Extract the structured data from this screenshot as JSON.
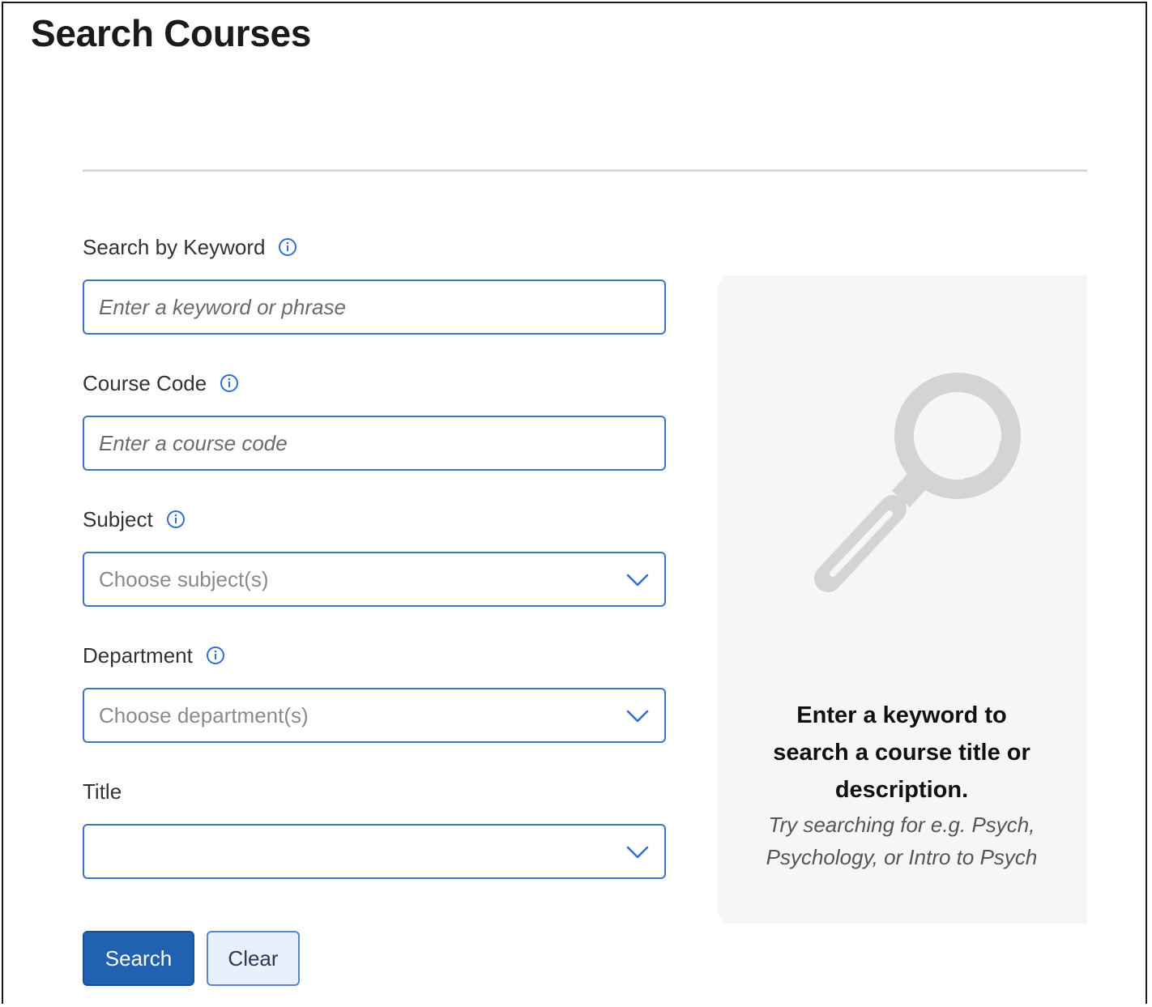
{
  "page": {
    "title": "Search Courses"
  },
  "form": {
    "keyword": {
      "label": "Search by Keyword",
      "placeholder": "Enter a keyword or phrase",
      "value": ""
    },
    "course_code": {
      "label": "Course Code",
      "placeholder": "Enter a course code",
      "value": ""
    },
    "subject": {
      "label": "Subject",
      "placeholder": "Choose subject(s)"
    },
    "department": {
      "label": "Department",
      "placeholder": "Choose department(s)"
    },
    "title": {
      "label": "Title",
      "value": ""
    }
  },
  "actions": {
    "search_label": "Search",
    "clear_label": "Clear"
  },
  "hint_panel": {
    "icon": "magnifying-glass-icon",
    "heading_line1": "Enter a keyword to",
    "heading_line2": "search a course title or",
    "heading_line3": "description.",
    "sub_line1": "Try searching for e.g. Psych,",
    "sub_line2": "Psychology, or Intro to Psych"
  },
  "colors": {
    "accent": "#2062b0",
    "field_border": "#3d74c9",
    "info_icon": "#2e6fd1",
    "panel_bg": "#f5f6f8"
  }
}
